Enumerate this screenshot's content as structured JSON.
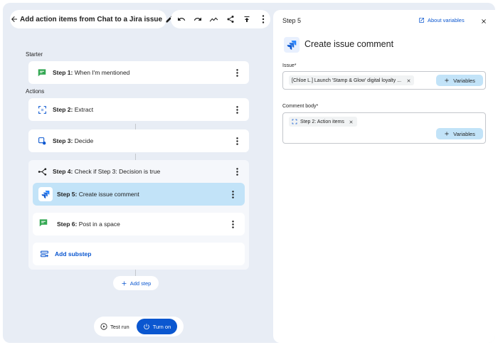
{
  "header": {
    "title": "Add action items from Chat to a Jira issue",
    "icons": [
      "arrow-back-icon",
      "pencil-icon",
      "undo-icon",
      "redo-icon",
      "activity-icon",
      "share-icon",
      "publish-icon",
      "more-vert-icon"
    ]
  },
  "flow": {
    "starter_label": "Starter",
    "actions_label": "Actions",
    "steps": [
      {
        "prefix": "Step 1:",
        "text": "When I'm mentioned",
        "icon": "chat-icon"
      },
      {
        "prefix": "Step 2:",
        "text": "Extract",
        "icon": "extract-icon"
      },
      {
        "prefix": "Step 3:",
        "text": "Decide",
        "icon": "decide-icon"
      },
      {
        "prefix": "Step 4:",
        "text": "Check if Step 3: Decision is true",
        "icon": "branch-icon"
      },
      {
        "prefix": "Step 5:",
        "text": "Create issue comment",
        "icon": "jira-icon",
        "selected": true
      },
      {
        "prefix": "Step 6:",
        "text": "Post in a space",
        "icon": "chat-icon"
      }
    ],
    "add_substep_label": "Add substep",
    "add_step_label": "Add step",
    "test_run_label": "Test run",
    "turn_on_label": "Turn on"
  },
  "panel": {
    "step_label": "Step 5",
    "about_label": "About variables",
    "title": "Create issue comment",
    "issue_label": "Issue*",
    "issue_chip": "[Chloe L.] Launch 'Stamp & Glow' digital loyalty ...",
    "variables_label": "Variables",
    "comment_label": "Comment body*",
    "comment_chip": "Step 2: Action items"
  },
  "colors": {
    "accent": "#0b57d0",
    "selected": "#c2e3f8",
    "chat_green": "#34a853",
    "jira_blue": "#2684ff"
  }
}
